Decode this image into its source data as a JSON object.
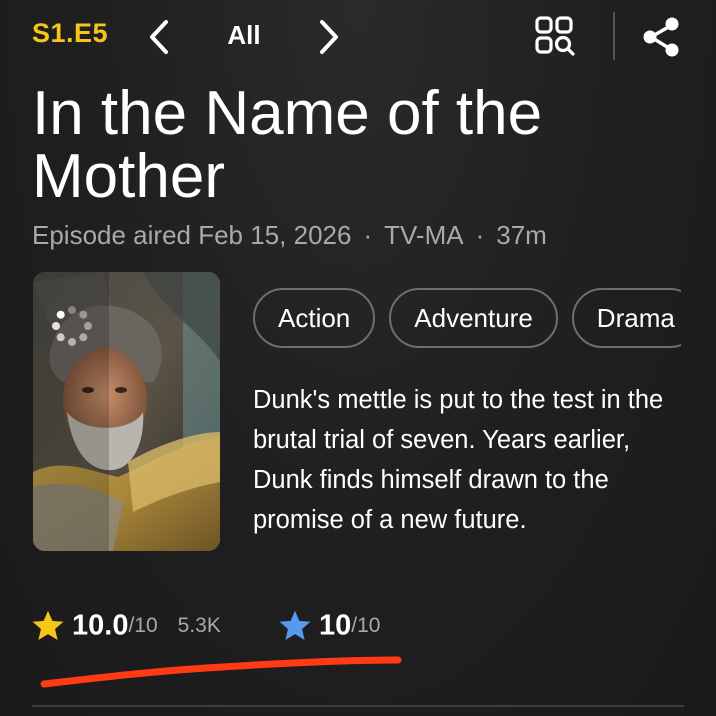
{
  "header": {
    "episode_code": "S1.E5",
    "nav_label": "All",
    "prev_icon": "chevron-left-icon",
    "next_icon": "chevron-right-icon",
    "grid_icon": "episode-grid-search-icon",
    "share_icon": "share-icon",
    "accent_color": "#f5c518"
  },
  "episode": {
    "title": "In the Name of the Mother",
    "aired": "Episode aired Feb 15, 2026",
    "separator": "·",
    "certificate": "TV-MA",
    "runtime": "37m",
    "poster_icon": "episode-still-image",
    "loading_icon": "loading-spinner-icon"
  },
  "genres": [
    "Action",
    "Adventure",
    "Drama"
  ],
  "plot": "Dunk's mettle is put to the test in the brutal trial of seven. Years earlier, Dunk finds himself drawn to the promise of a new future.",
  "ratings": {
    "imdb": {
      "value": "10.0",
      "scale": "/10",
      "count": "5.3K",
      "icon": "star-yellow-icon",
      "color": "#f5c518"
    },
    "user": {
      "value": "10",
      "scale": "/10",
      "icon": "star-blue-icon",
      "color": "#5799ef"
    },
    "annotation_color": "#ff3b14"
  }
}
